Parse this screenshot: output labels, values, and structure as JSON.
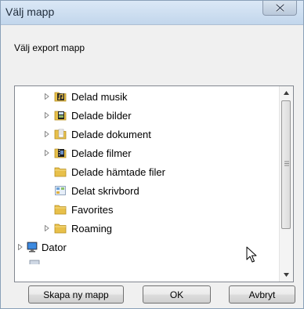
{
  "window": {
    "title": "Välj mapp",
    "close_icon": "close-x-icon"
  },
  "prompt": "Välj export mapp",
  "tree": {
    "items": [
      {
        "label": "Delad musik",
        "icon": "music-folder-icon",
        "expandable": true
      },
      {
        "label": "Delade bilder",
        "icon": "pictures-folder-icon",
        "expandable": true
      },
      {
        "label": "Delade dokument",
        "icon": "documents-folder-icon",
        "expandable": true
      },
      {
        "label": "Delade filmer",
        "icon": "videos-folder-icon",
        "expandable": true
      },
      {
        "label": "Delade hämtade filer",
        "icon": "folder-icon",
        "expandable": false
      },
      {
        "label": "Delat skrivbord",
        "icon": "desktop-icon",
        "expandable": false
      },
      {
        "label": "Favorites",
        "icon": "folder-icon",
        "expandable": false
      },
      {
        "label": "Roaming",
        "icon": "folder-icon",
        "expandable": true
      },
      {
        "label": "Dator",
        "icon": "computer-icon",
        "expandable": true
      }
    ]
  },
  "buttons": {
    "new_folder": "Skapa ny mapp",
    "ok": "OK",
    "cancel": "Avbryt"
  },
  "colors": {
    "folder": "#e8c04a",
    "title_bar": "#c2d6ec"
  }
}
